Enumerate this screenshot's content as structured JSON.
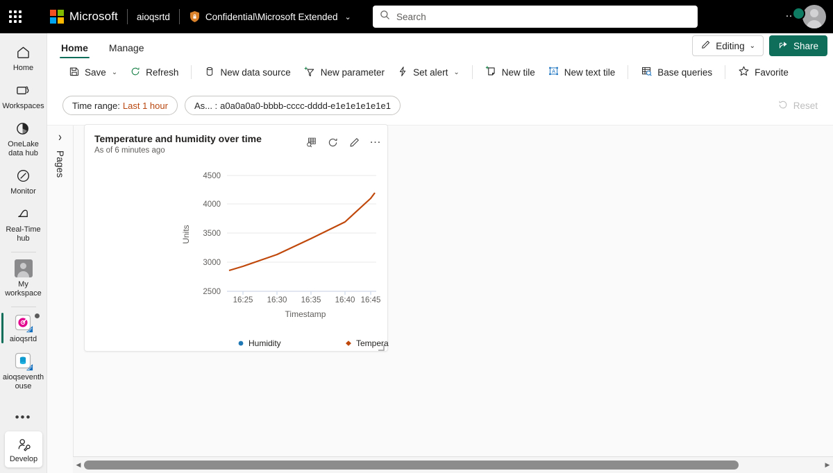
{
  "topbar": {
    "waffle_tooltip": "App launcher",
    "brand": "Microsoft",
    "workspace": "aioqsrtd",
    "sensitivity": "Confidential\\Microsoft Extended",
    "sensitivity_chevron": "⌄",
    "search_placeholder": "Search",
    "search_value": "",
    "more_dots": "…"
  },
  "rail": {
    "items": [
      {
        "label": "Home",
        "icon": "home-icon"
      },
      {
        "label": "Workspaces",
        "icon": "workspaces-icon"
      },
      {
        "label": "OneLake data hub",
        "icon": "onelake-icon"
      },
      {
        "label": "Monitor",
        "icon": "monitor-icon"
      },
      {
        "label": "Real-Time hub",
        "icon": "realtime-hub-icon"
      },
      {
        "label": "My workspace",
        "icon": "my-workspace-icon"
      },
      {
        "label": "aioqsrtd",
        "icon": "realtime-dashboard-icon"
      },
      {
        "label": "aioqseventhouse",
        "icon": "eventhouse-icon"
      }
    ],
    "more": "•••",
    "develop": {
      "label": "Develop",
      "icon": "develop-icon"
    }
  },
  "tabs": {
    "items": [
      {
        "label": "Home",
        "active": true
      },
      {
        "label": "Manage",
        "active": false
      }
    ],
    "editing": {
      "label": "Editing",
      "chevron": "⌄",
      "icon": "pencil-icon"
    },
    "share": {
      "label": "Share",
      "icon": "share-icon"
    }
  },
  "ribbon": {
    "commands": [
      {
        "label": "Save",
        "icon": "save-icon",
        "chevron": "⌄"
      },
      {
        "label": "Refresh",
        "icon": "refresh-icon",
        "chevron": ""
      },
      {
        "label": "New data source",
        "icon": "database-icon",
        "chevron": ""
      },
      {
        "label": "New parameter",
        "icon": "new-parameter-icon",
        "chevron": ""
      },
      {
        "label": "Set alert",
        "icon": "alert-bolt-icon",
        "chevron": "⌄"
      },
      {
        "label": "New tile",
        "icon": "new-tile-icon",
        "chevron": ""
      },
      {
        "label": "New text tile",
        "icon": "new-text-tile-icon",
        "chevron": ""
      },
      {
        "label": "Base queries",
        "icon": "base-queries-icon",
        "chevron": ""
      },
      {
        "label": "Favorite",
        "icon": "star-icon",
        "chevron": ""
      }
    ]
  },
  "filterbar": {
    "pills": [
      {
        "label": "Time range:",
        "value": "Last 1 hour",
        "accent": true
      },
      {
        "label": "As... :",
        "value": "a0a0a0a0-bbbb-cccc-dddd-e1e1e1e1e1e1",
        "accent": false
      }
    ],
    "reset": {
      "label": "Reset",
      "icon": "reset-icon",
      "disabled": true
    }
  },
  "pages_panel": {
    "label": "Pages",
    "expand_chevron": "›"
  },
  "tile": {
    "title": "Temperature and humidity over time",
    "subtitle": "As of 6 minutes ago",
    "actions": [
      {
        "name": "explore-data-icon",
        "label": "Explore data"
      },
      {
        "name": "refresh-icon",
        "label": "Refresh"
      },
      {
        "name": "edit-pencil-icon",
        "label": "Edit"
      },
      {
        "name": "more-options-icon",
        "label": "More options"
      }
    ]
  },
  "chart_data": {
    "type": "line",
    "title": "Temperature and humidity over time",
    "xlabel": "Timestamp",
    "ylabel": "Units",
    "xticks": [
      "16:25",
      "16:30",
      "16:35",
      "16:40",
      "16:45"
    ],
    "yticks": [
      2500,
      3000,
      3500,
      4000,
      4500
    ],
    "ylim": [
      2500,
      4600
    ],
    "grid": true,
    "legend_position": "bottom",
    "series": [
      {
        "name": "Humidity",
        "color": "#1f77b4",
        "marker": "circle",
        "x": [],
        "values": []
      },
      {
        "name": "Temperature",
        "color": "#c0480b",
        "marker": "diamond",
        "x": [
          "16:23",
          "16:25",
          "16:30",
          "16:35",
          "16:40",
          "16:45",
          "16:46"
        ],
        "values": [
          2850,
          2920,
          3120,
          3400,
          3680,
          4080,
          4170
        ]
      }
    ]
  },
  "scrollbar": {
    "left_arrow": "◀",
    "right_arrow": "▶"
  }
}
